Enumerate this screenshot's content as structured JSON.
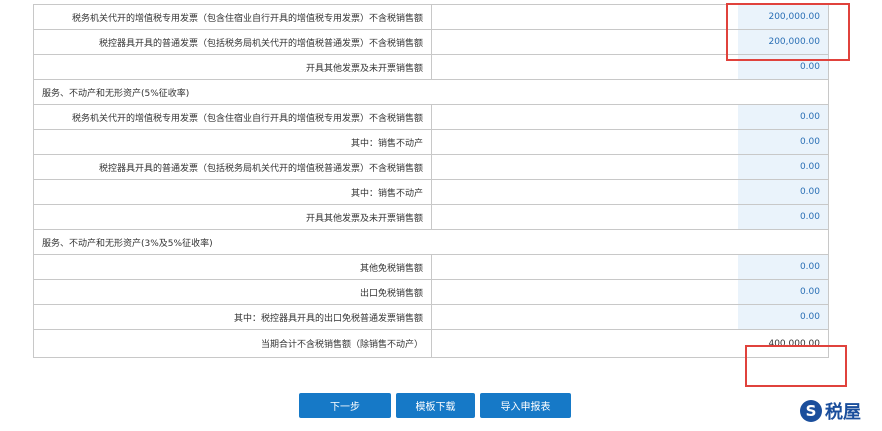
{
  "rows": [
    {
      "label": "税务机关代开的增值税专用发票（包含住宿业自行开具的增值税专用发票）不含税销售额",
      "value": "200,000.00"
    },
    {
      "label": "税控器具开具的普通发票（包括税务局机关代开的增值税普通发票）不含税销售额",
      "value": "200,000.00"
    },
    {
      "label": "开具其他发票及未开票销售额",
      "value": "0.00"
    },
    {
      "section": "服务、不动产和无形资产(5%征收率)"
    },
    {
      "label": "税务机关代开的增值税专用发票（包含住宿业自行开具的增值税专用发票）不含税销售额",
      "value": "0.00"
    },
    {
      "label": "其中：销售不动产",
      "value": "0.00"
    },
    {
      "label": "税控器具开具的普通发票（包括税务局机关代开的增值税普通发票）不含税销售额",
      "value": "0.00"
    },
    {
      "label": "其中：销售不动产",
      "value": "0.00"
    },
    {
      "label": "开具其他发票及未开票销售额",
      "value": "0.00"
    },
    {
      "section": "服务、不动产和无形资产(3%及5%征收率)"
    },
    {
      "label": "其他免税销售额",
      "value": "0.00"
    },
    {
      "label": "出口免税销售额",
      "value": "0.00"
    },
    {
      "label": "其中：税控器具开具的出口免税普通发票销售额",
      "value": "0.00"
    },
    {
      "label": "当期合计不含税销售额（除销售不动产）",
      "value": "400,000.00",
      "total": true
    }
  ],
  "buttons": {
    "next": "下一步",
    "template_download": "模板下载",
    "import_report": "导入申报表"
  },
  "watermark": "税屋",
  "colors": {
    "highlight": "#e0423c",
    "button": "#1679c7",
    "value_text": "#2a6fb5"
  }
}
